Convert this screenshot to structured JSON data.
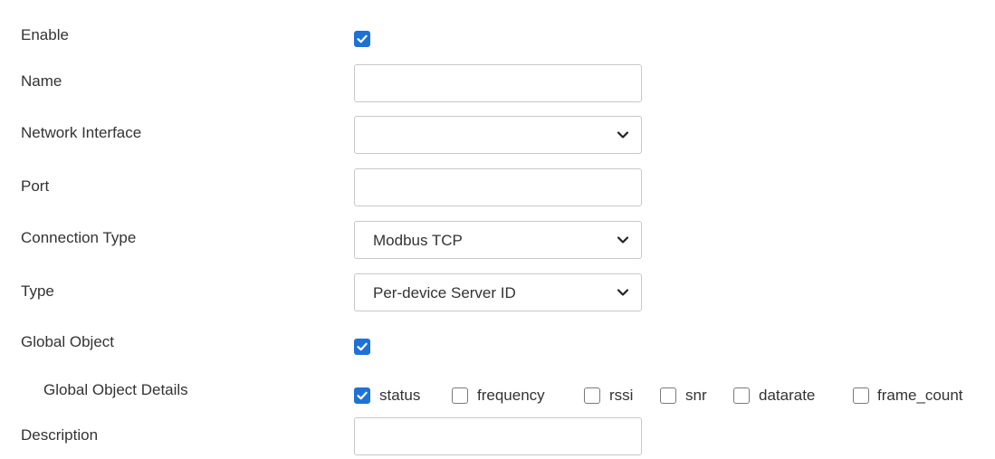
{
  "form": {
    "enable": {
      "label": "Enable",
      "checked": true
    },
    "name": {
      "label": "Name",
      "value": ""
    },
    "network_interface": {
      "label": "Network Interface",
      "selected": ""
    },
    "port": {
      "label": "Port",
      "value": ""
    },
    "connection_type": {
      "label": "Connection Type",
      "selected": "Modbus TCP"
    },
    "type": {
      "label": "Type",
      "selected": "Per-device Server ID"
    },
    "global_object": {
      "label": "Global Object",
      "checked": true
    },
    "global_object_details": {
      "label": "Global Object Details",
      "options": [
        {
          "label": "status",
          "checked": true
        },
        {
          "label": "frequency",
          "checked": false
        },
        {
          "label": "rssi",
          "checked": false
        },
        {
          "label": "snr",
          "checked": false
        },
        {
          "label": "datarate",
          "checked": false
        },
        {
          "label": "frame_count",
          "checked": false
        }
      ]
    },
    "description": {
      "label": "Description",
      "value": ""
    }
  },
  "colors": {
    "checkbox_checked": "#1e71d6",
    "text": "#333333",
    "border": "#c8c8c8"
  },
  "icons": {
    "check": "checkmark-icon",
    "dropdown": "chevron-down-icon"
  }
}
